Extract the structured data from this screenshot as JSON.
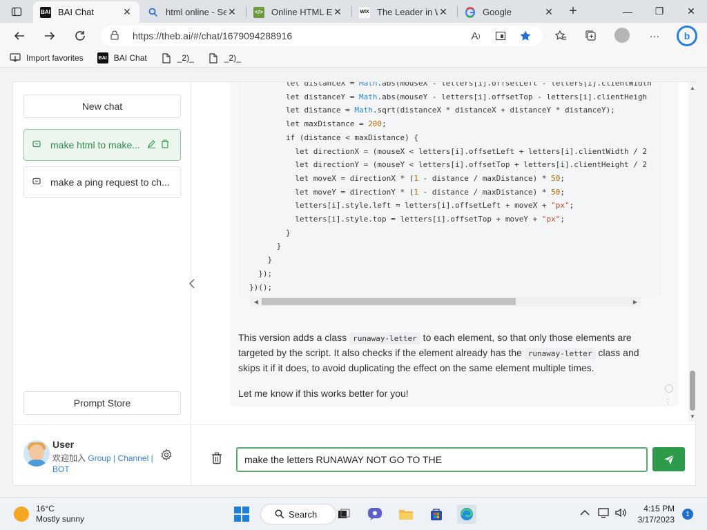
{
  "tabs": [
    {
      "title": "BAI Chat",
      "favicon": "bai-icon",
      "active": true
    },
    {
      "title": "html online - Sea",
      "favicon": "search-icon",
      "active": false
    },
    {
      "title": "Online HTML Edi",
      "favicon": "code-editor-icon",
      "active": false
    },
    {
      "title": "The Leader in W",
      "favicon": "wix-icon",
      "active": false
    },
    {
      "title": "Google",
      "favicon": "google-icon",
      "active": false
    }
  ],
  "tab_close_glyph": "✕",
  "new_tab_glyph": "+",
  "window_controls": {
    "minimize": "—",
    "maximize": "❐",
    "close": "✕"
  },
  "address": {
    "url": "https://theb.ai/#/chat/1679094288916"
  },
  "favorites": [
    {
      "label": "Import favorites",
      "icon": "import-icon"
    },
    {
      "label": "BAI Chat",
      "icon": "bai-icon"
    },
    {
      "label": "_2)_",
      "icon": "page-icon"
    },
    {
      "label": "_2)_",
      "icon": "page-icon"
    }
  ],
  "sidebar": {
    "new_chat_label": "New chat",
    "chats": [
      {
        "title": "make html to make...",
        "active": true
      },
      {
        "title": "make a ping request to ch...",
        "active": false
      }
    ],
    "prompt_store_label": "Prompt Store",
    "user": {
      "name": "User",
      "welcome": "欢迎加入",
      "link_group": "Group",
      "link_channel": "Channel",
      "link_bot": "BOT",
      "separator": "|"
    }
  },
  "code_lines": [
    "        let distanceX = Math.abs(mouseX - letters[i].offsetLeft - letters[i].clientWidth",
    "        let distanceY = Math.abs(mouseY - letters[i].offsetTop - letters[i].clientHeigh",
    "        let distance = Math.sqrt(distanceX * distanceX + distanceY * distanceY);",
    "        let maxDistance = 200;",
    "        if (distance < maxDistance) {",
    "          let directionX = (mouseX < letters[i].offsetLeft + letters[i].clientWidth / 2",
    "          let directionY = (mouseY < letters[i].offsetTop + letters[i].clientHeight / 2",
    "          let moveX = directionX * (1 - distance / maxDistance) * 50;",
    "          let moveY = directionY * (1 - distance / maxDistance) * 50;",
    "          letters[i].style.left = letters[i].offsetLeft + moveX + \"px\";",
    "          letters[i].style.top = letters[i].offsetTop + moveY + \"px\";",
    "        }",
    "      }",
    "    }",
    "  });",
    "})();"
  ],
  "message": {
    "p1_a": "This version adds a class ",
    "p1_code1": "runaway-letter",
    "p1_b": " to each element, so that only those elements are targeted by the script. It also checks if the element already has the ",
    "p1_code2": "runaway-letter",
    "p1_c": " class and skips it if it does, to avoid duplicating the effect on the same element multiple times.",
    "p2": "Let me know if this works better for you!"
  },
  "composer": {
    "value": "make the letters RUNAWAY NOT GO TO THE"
  },
  "taskbar": {
    "weather_temp": "16°C",
    "weather_desc": "Mostly sunny",
    "search_label": "Search",
    "time": "4:15 PM",
    "date": "3/17/2023",
    "notification_count": "1"
  },
  "colors": {
    "accent": "#2e9b4a",
    "link": "#3a82c4",
    "edge_blue": "#2a7fd8"
  }
}
